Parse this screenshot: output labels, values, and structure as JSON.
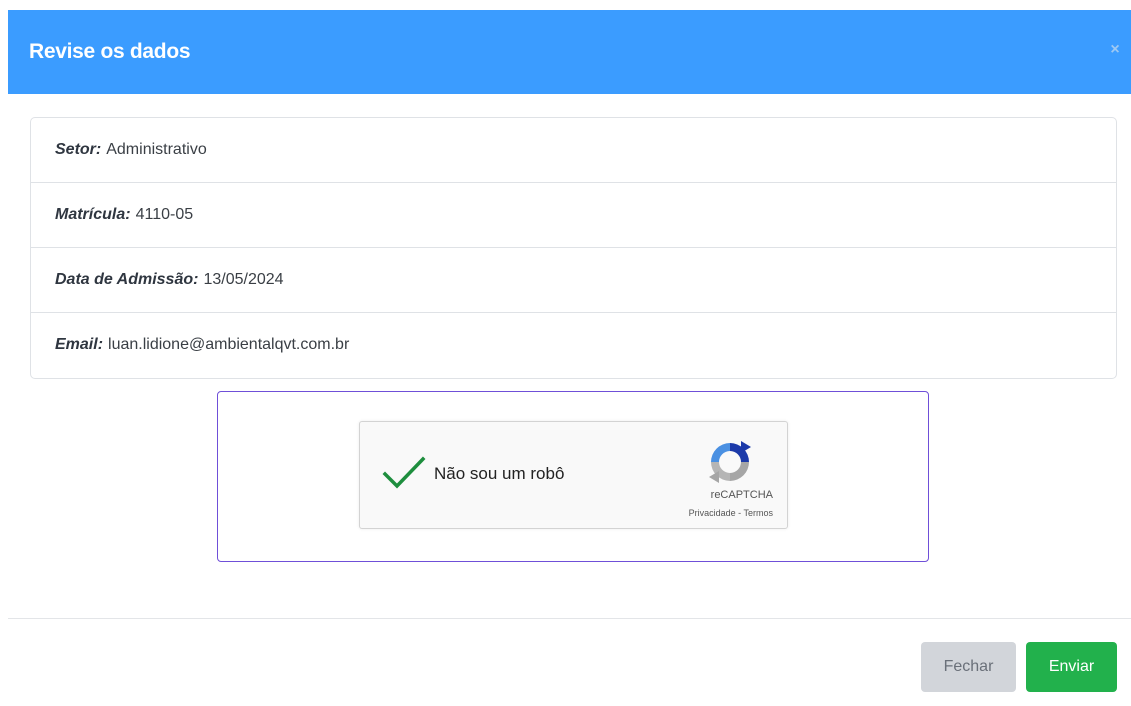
{
  "header": {
    "title": "Revise os dados",
    "close_symbol": "×"
  },
  "info": [
    {
      "label": "Setor:",
      "value": "Administrativo"
    },
    {
      "label": "Matrícula:",
      "value": "4110-05"
    },
    {
      "label": "Data de Admissão:",
      "value": "13/05/2024"
    },
    {
      "label": "Email:",
      "value": "luan.lidione@ambientalqvt.com.br"
    }
  ],
  "captcha": {
    "label": "Não sou um robô",
    "checked": true,
    "brand": "reCAPTCHA",
    "privacy_link": "Privacidade",
    "separator": " - ",
    "terms_link": "Termos",
    "check_icon": "check-icon",
    "logo_icon": "recaptcha-logo-icon",
    "check_color": "#1e8e3e"
  },
  "footer": {
    "close_label": "Fechar",
    "send_label": "Enviar"
  },
  "colors": {
    "header": "#3b9cff",
    "send_button": "#22b14c",
    "close_button": "#d2d5da",
    "captcha_border": "#6f4fd8"
  }
}
